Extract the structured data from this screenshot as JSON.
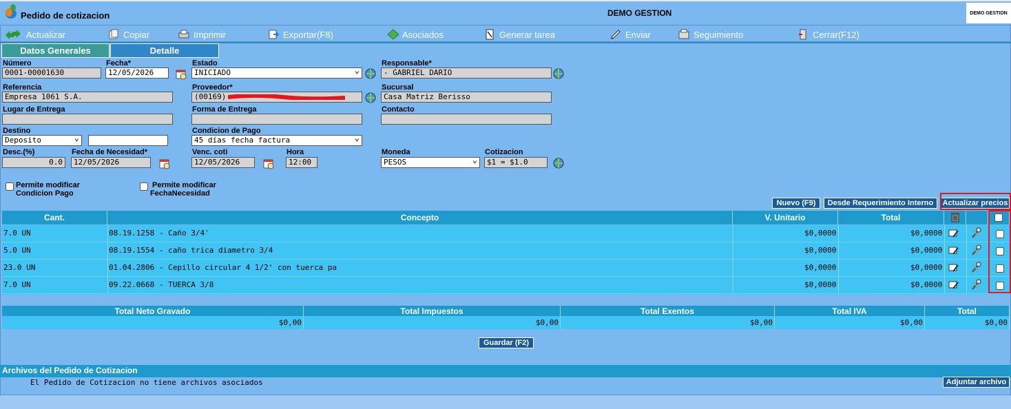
{
  "header": {
    "page_title": "Pedido de cotizacion",
    "company": "DEMO GESTION",
    "brand_logo": "DEMO GESTION"
  },
  "toolbar": [
    {
      "label": "Actualizar",
      "icon": "refresh-icon"
    },
    {
      "label": "Copiar",
      "icon": "copy-icon"
    },
    {
      "label": "Imprimir",
      "icon": "printer-icon"
    },
    {
      "label": "Exportar(F8)",
      "icon": "export-icon"
    },
    {
      "label": "Asociados",
      "icon": "associated-icon"
    },
    {
      "label": "Generar tarea",
      "icon": "task-icon"
    },
    {
      "label": "Enviar",
      "icon": "send-icon"
    },
    {
      "label": "Seguimiento",
      "icon": "tracking-icon"
    },
    {
      "label": "Cerrar(F12)",
      "icon": "close-icon"
    }
  ],
  "tabs": {
    "general": "Datos Generales",
    "detail": "Detalle"
  },
  "form": {
    "numero": {
      "label": "Número",
      "value": "0001-00001630"
    },
    "fecha": {
      "label": "Fecha*",
      "value": "12/05/2026"
    },
    "estado": {
      "label": "Estado",
      "value": "INICIADO"
    },
    "responsable": {
      "label": "Responsable*",
      "value": "- GABRIEL DARIO"
    },
    "referencia": {
      "label": "Referencia",
      "value": "Empresa 1061 S.A."
    },
    "proveedor": {
      "label": "Proveedor*",
      "value": "(00169)"
    },
    "sucursal": {
      "label": "Sucursal",
      "value": "Casa Matriz Berisso"
    },
    "lugar_entrega": {
      "label": "Lugar de Entrega",
      "value": ""
    },
    "forma_entrega": {
      "label": "Forma de Entrega",
      "value": ""
    },
    "contacto": {
      "label": "Contacto",
      "value": ""
    },
    "destino": {
      "label": "Destino",
      "value": "Deposito",
      "extra": ""
    },
    "condicion_pago": {
      "label": "Condicion de Pago",
      "value": "45 días fecha factura"
    },
    "descuento": {
      "label": "Desc.(%)",
      "value": "0.0"
    },
    "fecha_necesidad": {
      "label": "Fecha de Necesidad*",
      "value": "12/05/2026"
    },
    "venc_coti": {
      "label": "Venc. coti",
      "value": "12/05/2026"
    },
    "hora": {
      "label": "Hora",
      "value": "12:00"
    },
    "moneda": {
      "label": "Moneda",
      "value": "PESOS"
    },
    "cotizacion": {
      "label": "Cotizacion",
      "value": "$1 = $1.0"
    },
    "chk_condicion": {
      "line1": "Permite modificar",
      "line2": "Condicion Pago",
      "checked": false
    },
    "chk_fecha": {
      "line1": "Permite modificar",
      "line2": "FechaNecesidad",
      "checked": false
    }
  },
  "actions": {
    "nuevo": "Nuevo (F9)",
    "desde_req": "Desde Requerimiento Interno",
    "actualizar_precios": "Actualizar precios"
  },
  "items": {
    "columns": [
      "Cant.",
      "Concepto",
      "V. Unitario",
      "Total"
    ],
    "rows": [
      {
        "cant": "7.0 UN",
        "concepto": "08.19.1258 - Caño 3/4'",
        "unitario": "$0,0000",
        "total": "$0,0000"
      },
      {
        "cant": "5.0 UN",
        "concepto": "08.19.1554 - caño trica diametro 3/4",
        "unitario": "$0,0000",
        "total": "$0,0000"
      },
      {
        "cant": "23.0 UN",
        "concepto": "01.04.2806 - Cepillo circular 4 1/2' con tuerca pa",
        "unitario": "$0,0000",
        "total": "$0,0000"
      },
      {
        "cant": "7.0 UN",
        "concepto": "09.22.0668 - TUERCA 3/8",
        "unitario": "$0,0000",
        "total": "$0,0000"
      }
    ]
  },
  "totals": {
    "columns": [
      "Total Neto Gravado",
      "Total Impuestos",
      "Total Exentos",
      "Total IVA",
      "Total"
    ],
    "values": [
      "$0,00",
      "$0,00",
      "$0,00",
      "$0,00",
      "$0,00"
    ]
  },
  "save_button": "Guardar (F2)",
  "files": {
    "header": "Archivos del Pedido de Cotizacion",
    "empty": "El Pedido de Cotizacion no tiene archivos asociados",
    "attach_button": "Adjuntar archivo"
  },
  "colors": {
    "accent": "#1f9acd",
    "row": "#40c4f4",
    "highlight": "#e8141e"
  }
}
